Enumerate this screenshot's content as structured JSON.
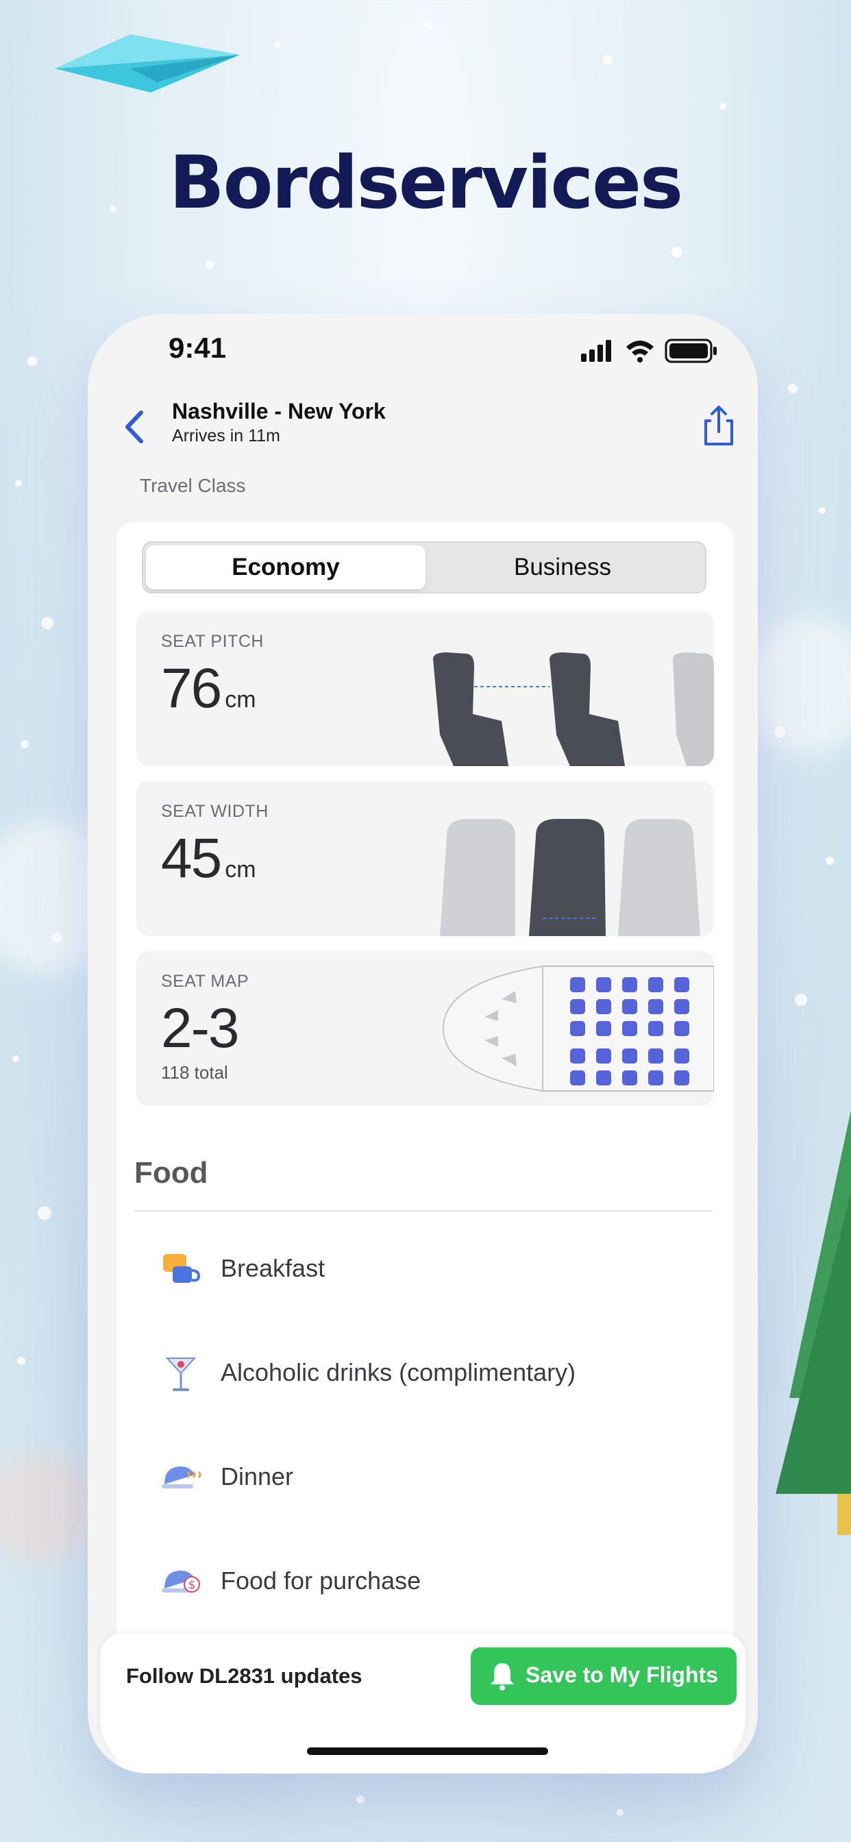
{
  "marketing": {
    "headline": "Bordservices"
  },
  "status_bar": {
    "time": "9:41"
  },
  "nav": {
    "title": "Nashville - New York",
    "subtitle": "Arrives in 11m"
  },
  "travel_class": {
    "section_label": "Travel Class",
    "tabs": [
      {
        "label": "Economy",
        "selected": true
      },
      {
        "label": "Business",
        "selected": false
      }
    ]
  },
  "specs": {
    "seat_pitch": {
      "label": "SEAT PITCH",
      "value": "76",
      "unit": "cm"
    },
    "seat_width": {
      "label": "SEAT WIDTH",
      "value": "45",
      "unit": "cm"
    },
    "seat_map": {
      "label": "SEAT MAP",
      "value": "2-3",
      "note": "118 total"
    }
  },
  "food": {
    "title": "Food",
    "items": [
      {
        "label": "Breakfast",
        "icon": "breakfast-icon"
      },
      {
        "label": "Alcoholic drinks (complimentary)",
        "icon": "cocktail-icon"
      },
      {
        "label": "Dinner",
        "icon": "dinner-icon"
      },
      {
        "label": "Food for purchase",
        "icon": "food-purchase-icon"
      }
    ]
  },
  "bottom_bar": {
    "follow_text": "Follow DL2831 updates",
    "save_label": "Save to My Flights"
  },
  "colors": {
    "accent_blue": "#2e5bd6",
    "save_green": "#33c55a",
    "headline_navy": "#141a55"
  }
}
